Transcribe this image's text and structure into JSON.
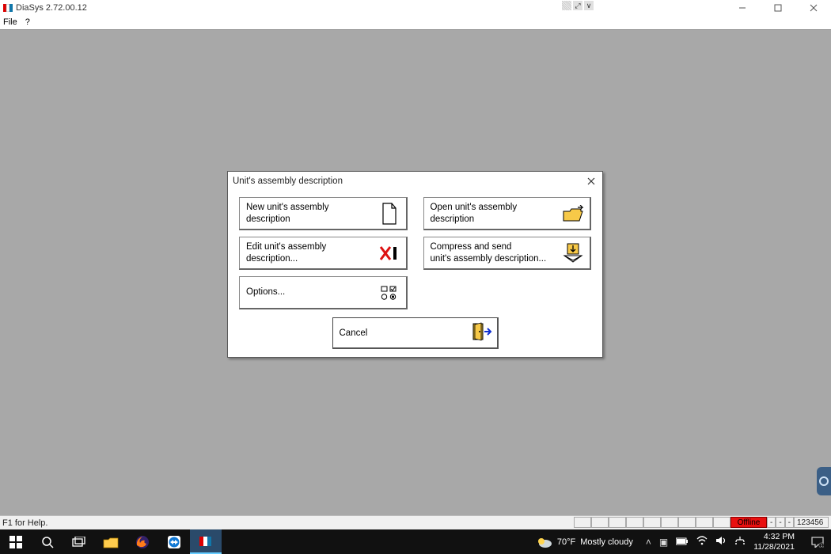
{
  "window": {
    "title": "DiaSys 2.72.00.12"
  },
  "menu": {
    "file": "File",
    "help": "?"
  },
  "dialog": {
    "title": "Unit's assembly description",
    "new_desc": "New unit's assembly\ndescription",
    "open_desc": "Open unit's assembly\ndescription",
    "edit_desc": "Edit unit's assembly\ndescription...",
    "compress_desc": "Compress and send\nunit's assembly description...",
    "options": "Options...",
    "cancel": "Cancel"
  },
  "statusbar": {
    "help": "F1 for Help.",
    "offline": "Offline",
    "counter": "123456"
  },
  "taskbar": {
    "weather_temp": "70°F",
    "weather_cond": "Mostly cloudy",
    "time": "4:32 PM",
    "date": "11/28/2021"
  }
}
